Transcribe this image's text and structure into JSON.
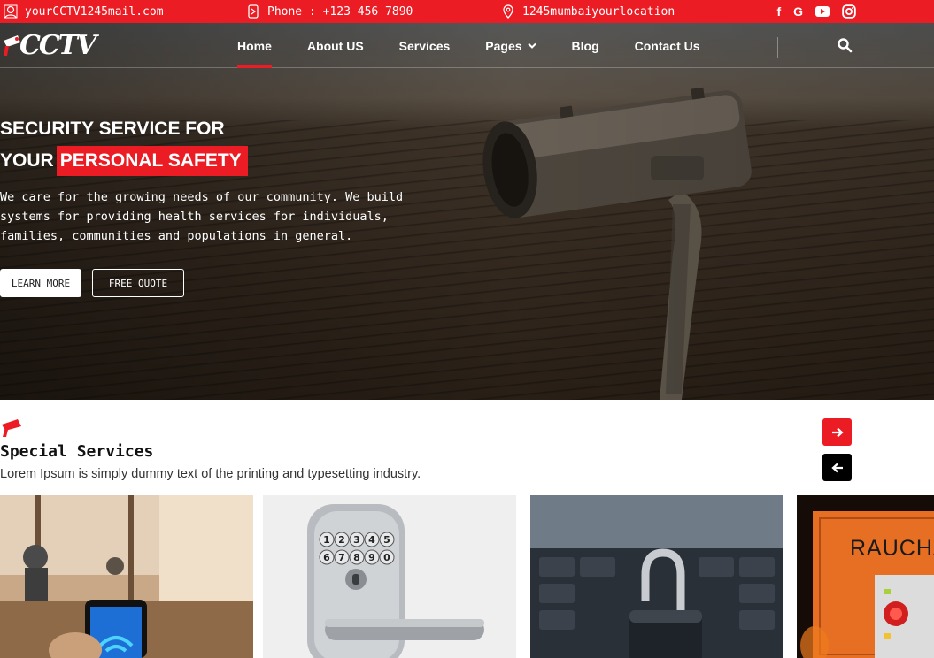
{
  "topbar": {
    "email": "yourCCTV1245mail.com",
    "phone": "Phone : +123 456 7890",
    "location": "1245mumbaiyourlocation",
    "social": [
      "facebook-icon",
      "google-icon",
      "youtube-icon",
      "instagram-icon"
    ],
    "social_glyphs": {
      "facebook": "f",
      "google": "G"
    }
  },
  "brand": {
    "logo_text": "CCTV"
  },
  "nav": {
    "items": [
      "Home",
      "About US",
      "Services",
      "Pages",
      "Blog",
      "Contact Us"
    ],
    "active": "Home"
  },
  "hero": {
    "title_line1": "SECURITY SERVICE FOR",
    "title_line2_prefix": "YOUR",
    "title_line2_highlight": "PERSONAL SAFETY",
    "description": "We care for the growing needs of our community. We build systems for providing health services for individuals, families, communities and populations in general.",
    "buttons": {
      "learn_more": "LEARN MORE",
      "free_quote": "FREE QUOTE"
    }
  },
  "services": {
    "title": "Special Services",
    "subtitle": "Lorem Ipsum is simply dummy text of the printing and typesetting industry.",
    "cards": [
      {
        "image": "smartphone-in-cafe"
      },
      {
        "image": "keypad-door-lock",
        "keypad_digits": [
          "1",
          "2",
          "3",
          "4",
          "5",
          "6",
          "7",
          "8",
          "9",
          "0"
        ]
      },
      {
        "image": "padlock-on-keyboard"
      },
      {
        "image": "smoke-alarm-panel",
        "label": "RAUCHA"
      }
    ]
  },
  "colors": {
    "accent": "#ec1c24",
    "dark": "#000000"
  }
}
